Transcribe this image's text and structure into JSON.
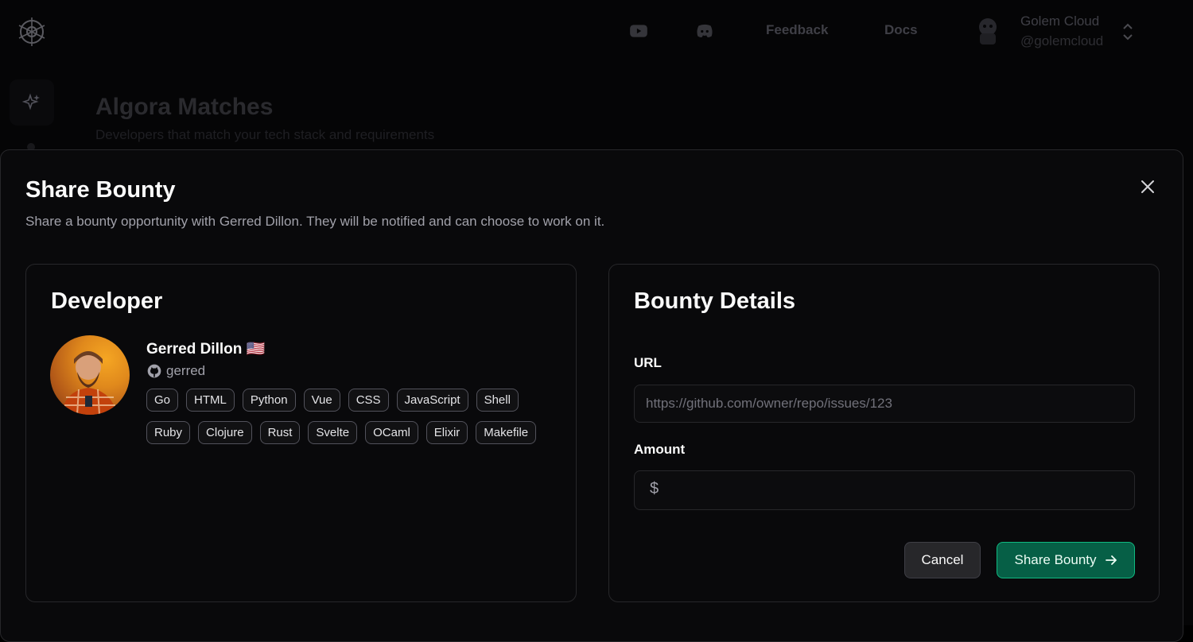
{
  "background": {
    "nav": {
      "youtube_icon": "youtube-icon",
      "discord_icon": "discord-icon",
      "feedback": "Feedback",
      "docs": "Docs"
    },
    "org": {
      "name": "Golem Cloud",
      "handle": "@golemcloud"
    },
    "page": {
      "title": "Algora Matches",
      "subtitle": "Developers that match your tech stack and requirements"
    }
  },
  "modal": {
    "title": "Share Bounty",
    "description": "Share a bounty opportunity with Gerred Dillon. They will be notified and can choose to work on it.",
    "developer_card": {
      "title": "Developer",
      "name": "Gerred Dillon 🇺🇸",
      "github_handle": "gerred",
      "tags": [
        "Go",
        "HTML",
        "Python",
        "Vue",
        "CSS",
        "JavaScript",
        "Shell",
        "Ruby",
        "Clojure",
        "Rust",
        "Svelte",
        "OCaml",
        "Elixir",
        "Makefile"
      ]
    },
    "details_card": {
      "title": "Bounty Details",
      "url_label": "URL",
      "url_placeholder": "https://github.com/owner/repo/issues/123",
      "url_value": "",
      "amount_label": "Amount",
      "amount_prefix": "$",
      "amount_value": "",
      "cancel_label": "Cancel",
      "share_label": "Share Bounty"
    }
  },
  "colors": {
    "accent": "#065f46",
    "accent_border": "#10b981",
    "surface": "#09090b",
    "border": "#27272a"
  }
}
